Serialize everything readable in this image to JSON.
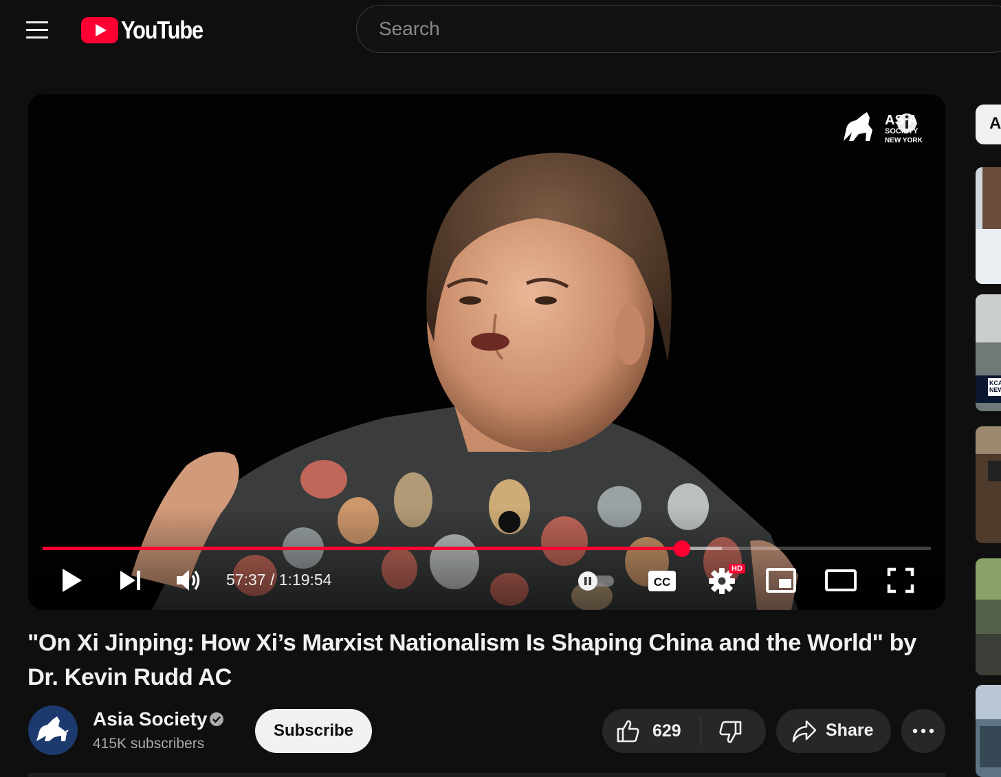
{
  "header": {
    "logo_text": "YouTube",
    "search_placeholder": "Search"
  },
  "player": {
    "watermark": {
      "line1": "ASIA",
      "line2": "SOCIETY",
      "line3": "NEW YORK"
    },
    "current_time": "57:37",
    "duration": "1:19:54",
    "time_display": "57:37 / 1:19:54",
    "progress_played_fraction": 0.72,
    "progress_buffered_fraction": 0.765,
    "hd_badge": "HD",
    "cc_label": "CC",
    "state": "paused",
    "accent_color": "#ff0033"
  },
  "video": {
    "title": "\"On Xi Jinping: How Xi’s Marxist Nationalism Is Shaping China and the World\" by Dr. Kevin Rudd AC"
  },
  "channel": {
    "name": "Asia Society",
    "verified": true,
    "subscribers": "415K subscribers",
    "subscribe_label": "Subscribe"
  },
  "actions": {
    "like_count": "629",
    "share_label": "Share",
    "more_label": "···"
  },
  "sidebar": {
    "chip_label": "A",
    "thumb_badge": "KCA NEW"
  },
  "icons": [
    "hamburger-menu-icon",
    "youtube-logo-icon",
    "play-icon",
    "next-icon",
    "volume-icon",
    "autoplay-toggle-icon",
    "cc-icon",
    "settings-gear-icon",
    "miniplayer-icon",
    "theater-mode-icon",
    "fullscreen-icon",
    "verified-badge-icon",
    "thumbs-up-icon",
    "thumbs-down-icon",
    "share-arrow-icon",
    "more-horizontal-icon"
  ]
}
